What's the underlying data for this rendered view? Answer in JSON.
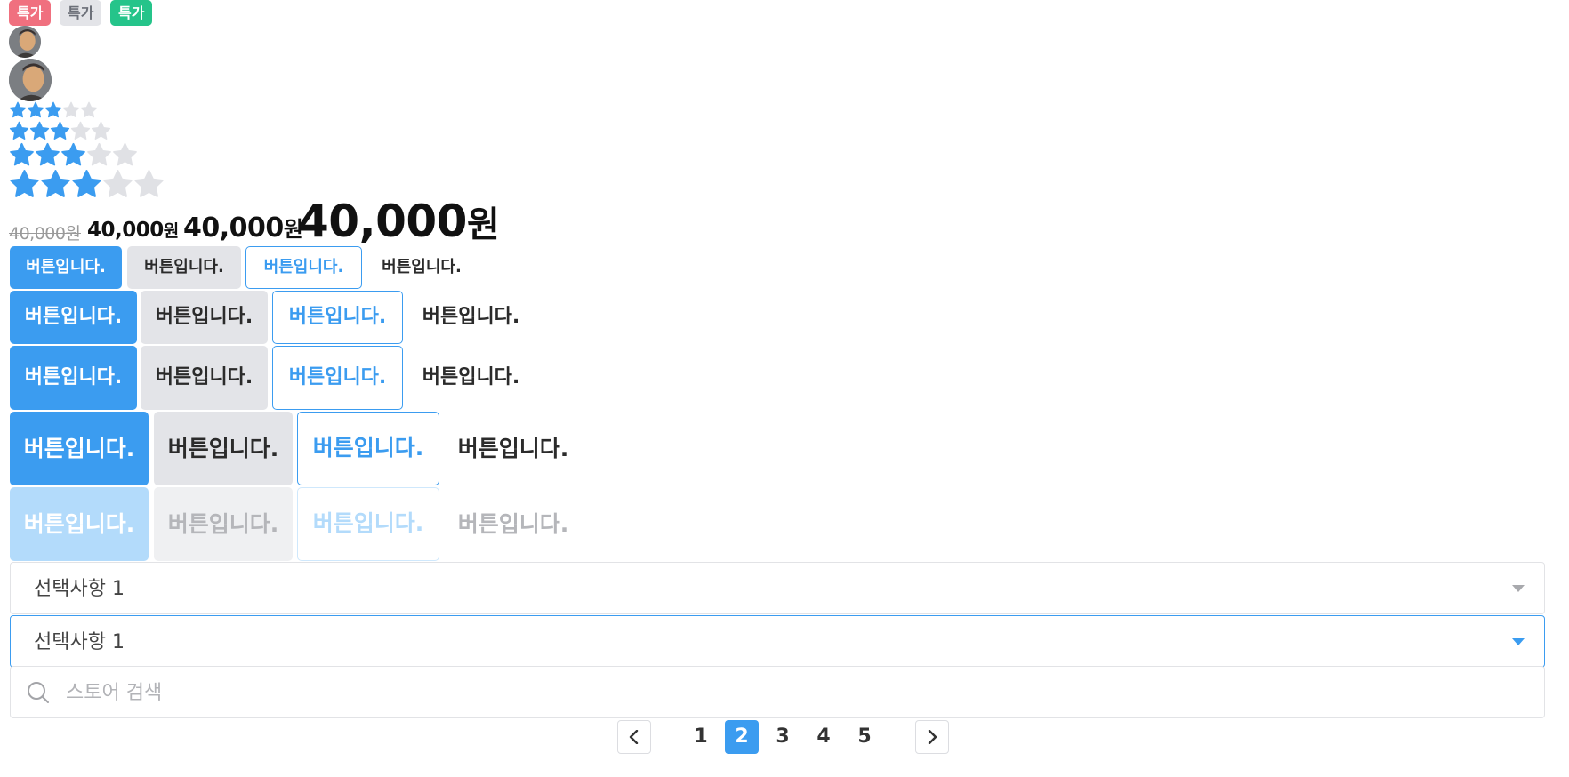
{
  "badges": [
    {
      "label": "특가",
      "variant": "red"
    },
    {
      "label": "특가",
      "variant": "gray"
    },
    {
      "label": "특가",
      "variant": "green"
    }
  ],
  "rating": {
    "value": 3,
    "max": 5,
    "color_filled": "#3b9cf0",
    "color_empty": "#e0e1e5"
  },
  "prices": {
    "xs": {
      "amount": "40,000",
      "unit": "원"
    },
    "sm": {
      "amount": "40,000",
      "unit": "원"
    },
    "md": {
      "amount": "40,000",
      "unit": "원"
    },
    "lg": {
      "amount": "40,000",
      "unit": "원"
    }
  },
  "buttons": {
    "label": "버튼입니다.",
    "variants": [
      "primary",
      "secondary",
      "outline",
      "text"
    ]
  },
  "selects": [
    {
      "value": "선택사항 1",
      "state": "default"
    },
    {
      "value": "선택사항 1",
      "state": "focused"
    }
  ],
  "search": {
    "placeholder": "스토어 검색"
  },
  "pagination": {
    "pages": [
      "1",
      "2",
      "3",
      "4",
      "5"
    ],
    "current": "2"
  },
  "colors": {
    "primary": "#3b9cf0",
    "secondary": "#e3e4e8",
    "badge_red": "#f0707f",
    "badge_green": "#25c48a"
  }
}
